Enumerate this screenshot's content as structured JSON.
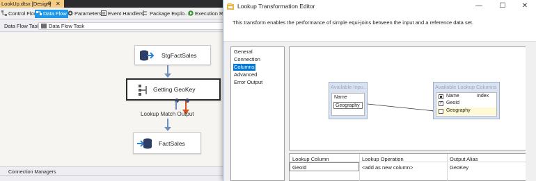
{
  "ssis": {
    "doc_tab": {
      "title": "LookUp.dtsx [Design]",
      "pin": "⊕",
      "close": "✕"
    },
    "designer_tabs": [
      {
        "label": "Control Flow",
        "active": false,
        "icon": "control-flow-icon"
      },
      {
        "label": "Data Flow",
        "active": true,
        "icon": "data-flow-icon"
      },
      {
        "label": "Parameters",
        "active": false,
        "icon": "parameters-icon"
      },
      {
        "label": "Event Handlers",
        "active": false,
        "icon": "event-handlers-icon"
      },
      {
        "label": "Package Explo...",
        "active": false,
        "icon": "package-explorer-icon"
      },
      {
        "label": "Execution Res",
        "active": false,
        "icon": "execution-results-icon"
      }
    ],
    "task_label": "Data Flow Task:",
    "task_value": "Data Flow Task",
    "nodes": {
      "source": "StgFactSales",
      "lookup": "Getting GeoKey",
      "destination": "FactSales"
    },
    "flow_label": "Lookup Match Output",
    "connection_managers_tab": "Connection Managers"
  },
  "dialog": {
    "title": "Lookup Transformation Editor",
    "minimize": "—",
    "maximize": "☐",
    "close": "✕",
    "description": "This transform enables the performance of simple equi-joins between the input and a reference data set.",
    "nav_items": [
      "General",
      "Connection",
      "Columns",
      "Advanced",
      "Error Output"
    ],
    "active_nav": "Columns",
    "input_box": {
      "header": "Available Inpu...",
      "col_header": "Name",
      "rows": [
        "Geography"
      ]
    },
    "lookup_box": {
      "header": "Available Lookup Columns",
      "col_headers": [
        "Name",
        "Index"
      ],
      "rows": [
        {
          "name": "GeoId",
          "checked": true
        },
        {
          "name": "Geography",
          "checked": false
        }
      ]
    },
    "grid": {
      "headers": [
        "Lookup Column",
        "Lookup Operation",
        "Output Alias"
      ],
      "rows": [
        [
          "GeoId",
          "<add as new column>",
          "GeoKey"
        ]
      ]
    }
  },
  "colors": {
    "accent": "#1c97ea",
    "doc_tab": "#f5cc84",
    "nav_selected": "#0078d7",
    "error_arrow": "#d9541e",
    "flow_arrow": "#6d8fbd"
  }
}
